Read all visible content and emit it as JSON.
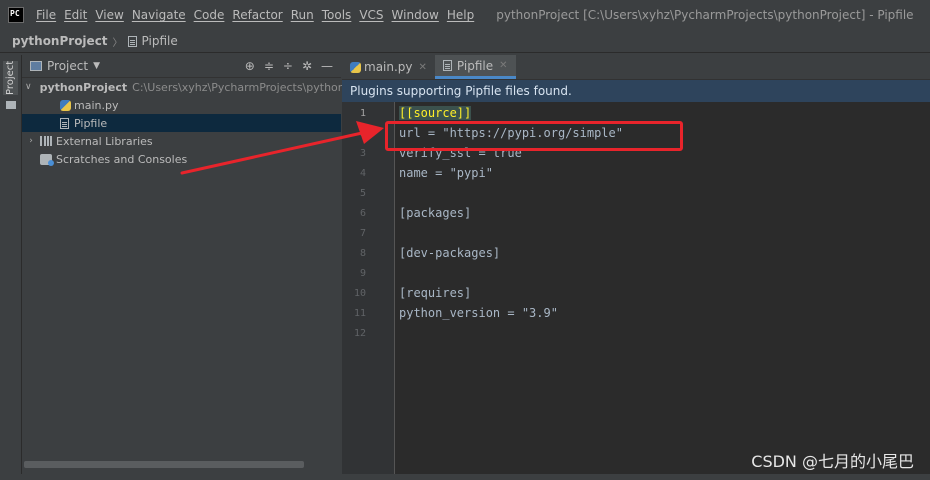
{
  "menubar": {
    "logo": "PC",
    "items": [
      "File",
      "Edit",
      "View",
      "Navigate",
      "Code",
      "Refactor",
      "Run",
      "Tools",
      "VCS",
      "Window",
      "Help"
    ],
    "window_title": "pythonProject [C:\\Users\\xyhz\\PycharmProjects\\pythonProject] - Pipfile"
  },
  "breadcrumbs": {
    "project": "pythonProject",
    "file": "Pipfile"
  },
  "toolstrip": {
    "project_tab": "Project"
  },
  "project_panel": {
    "title": "Project",
    "tree": {
      "root_name": "pythonProject",
      "root_path": "C:\\Users\\xyhz\\PycharmProjects\\pythonProject",
      "main_py": "main.py",
      "pipfile": "Pipfile",
      "external_libraries": "External Libraries",
      "scratches": "Scratches and Consoles"
    }
  },
  "editor": {
    "tabs": [
      {
        "label": "main.py"
      },
      {
        "label": "Pipfile"
      }
    ],
    "notice": "Plugins supporting Pipfile files found.",
    "lines": [
      {
        "no": "1",
        "text": "[[source]]"
      },
      {
        "no": "2",
        "text": "url = \"https://pypi.org/simple\""
      },
      {
        "no": "3",
        "text": "verify_ssl = true"
      },
      {
        "no": "4",
        "text": "name = \"pypi\""
      },
      {
        "no": "5",
        "text": ""
      },
      {
        "no": "6",
        "text": "[packages]"
      },
      {
        "no": "7",
        "text": ""
      },
      {
        "no": "8",
        "text": "[dev-packages]"
      },
      {
        "no": "9",
        "text": ""
      },
      {
        "no": "10",
        "text": "[requires]"
      },
      {
        "no": "11",
        "text": "python_version = \"3.9\""
      },
      {
        "no": "12",
        "text": ""
      }
    ]
  },
  "annotation": {
    "color": "#e8242b"
  },
  "watermark": "CSDN @七月的小尾巴"
}
